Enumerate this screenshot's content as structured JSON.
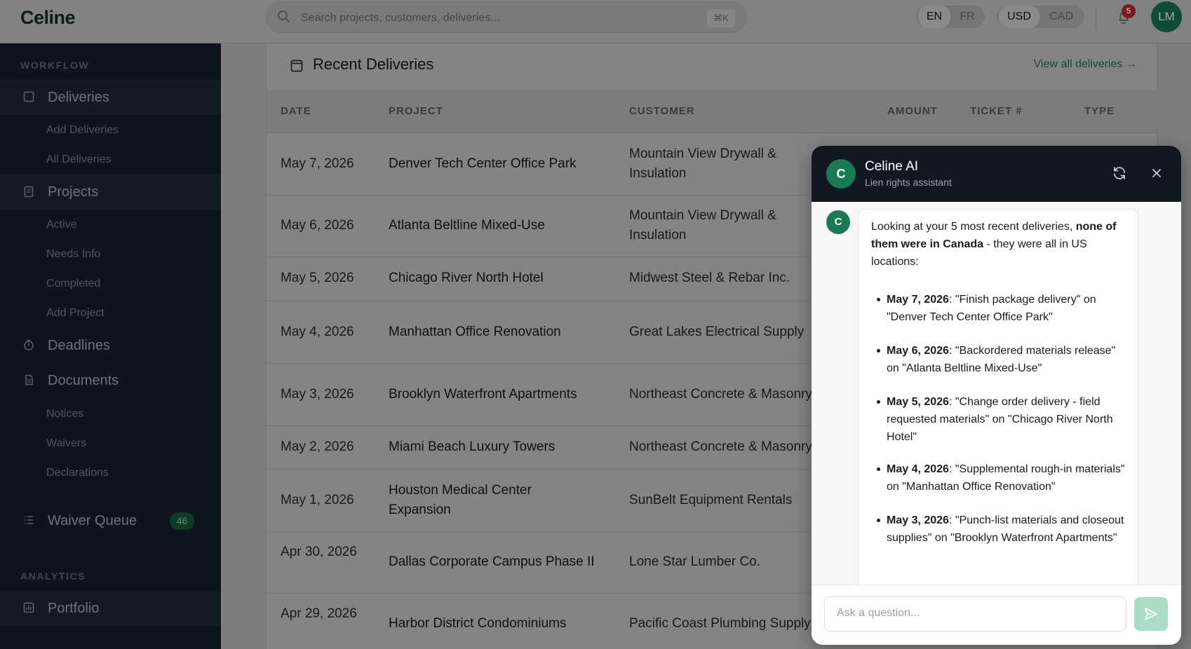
{
  "app": {
    "logo": "Celine"
  },
  "header": {
    "search_placeholder": "Search projects, customers, deliveries...",
    "search_shortcut": "⌘K",
    "languages": [
      "EN",
      "FR"
    ],
    "active_language": "EN",
    "currencies": [
      "USD",
      "CAD"
    ],
    "active_currency": "USD",
    "notifications_count": "5",
    "avatar_initials": "LM"
  },
  "sidebar": {
    "workflow_label": "WORKFLOW",
    "analytics_label": "ANALYTICS",
    "deliveries": {
      "label": "Deliveries",
      "icon": "square-icon"
    },
    "deliveries_sub": [
      "Add Deliveries",
      "All Deliveries"
    ],
    "projects": {
      "label": "Projects",
      "icon": "clipboard-icon"
    },
    "projects_sub": [
      "Active",
      "Needs Info",
      "Completed",
      "Add Project"
    ],
    "deadlines": {
      "label": "Deadlines",
      "icon": "timer-icon"
    },
    "documents": {
      "label": "Documents",
      "icon": "document-icon"
    },
    "documents_sub": [
      "Notices",
      "Waivers",
      "Declarations"
    ],
    "waiver_queue": {
      "label": "Waiver Queue",
      "icon": "list-icon",
      "count": "46"
    },
    "portfolio": {
      "label": "Portfolio",
      "icon": "chart-icon"
    }
  },
  "deliveries_card": {
    "title": "Recent Deliveries",
    "view_all": "View all deliveries →",
    "columns": [
      "DATE",
      "PROJECT",
      "CUSTOMER",
      "AMOUNT",
      "TICKET #",
      "TYPE"
    ],
    "rows": [
      {
        "date": "May 7, 2026",
        "project": "Denver Tech Center Office Park",
        "customer": "Mountain View Drywall & Insulation"
      },
      {
        "date": "May 6, 2026",
        "project": "Atlanta Beltline Mixed-Use",
        "customer": "Mountain View Drywall & Insulation"
      },
      {
        "date": "May 5, 2026",
        "project": "Chicago River North Hotel",
        "customer": "Midwest Steel & Rebar Inc."
      },
      {
        "date": "May 4, 2026",
        "project": "Manhattan Office Renovation",
        "customer": "Great Lakes Electrical Supply"
      },
      {
        "date": "May 3, 2026",
        "project": "Brooklyn Waterfront Apartments",
        "customer": "Northeast Concrete & Masonry"
      },
      {
        "date": "May 2, 2026",
        "project": "Miami Beach Luxury Towers",
        "customer": "Northeast Concrete & Masonry"
      },
      {
        "date": "May 1, 2026",
        "project": "Houston Medical Center Expansion",
        "customer": "SunBelt Equipment Rentals"
      },
      {
        "date": "Apr 30, 2026",
        "project": "Dallas Corporate Campus Phase II",
        "customer": "Lone Star Lumber Co."
      },
      {
        "date": "Apr 29, 2026",
        "project": "Harbor District Condominiums",
        "customer": "Pacific Coast Plumbing Supply"
      }
    ]
  },
  "chat": {
    "avatar_letter": "C",
    "name": "Celine AI",
    "subtitle": "Lien rights assistant",
    "intro_pre": "Looking at your 5 most recent deliveries, ",
    "intro_bold": "none of them were in Canada",
    "intro_post": " - they were all in US locations:",
    "items": [
      {
        "date": "May 7, 2026",
        "text": ": \"Finish package delivery\" on \"Denver Tech Center Office Park\""
      },
      {
        "date": "May 6, 2026",
        "text": ": \"Backordered materials release\" on \"Atlanta Beltline Mixed-Use\""
      },
      {
        "date": "May 5, 2026",
        "text": ": \"Change order delivery - field requested materials\" on \"Chicago River North Hotel\""
      },
      {
        "date": "May 4, 2026",
        "text": ": \"Supplemental rough-in materials\" on \"Manhattan Office Renovation\""
      },
      {
        "date": "May 3, 2026",
        "text": ": \"Punch-list materials and closeout supplies\" on \"Brooklyn Waterfront Apartments\""
      }
    ],
    "input_placeholder": "Ask a question..."
  }
}
